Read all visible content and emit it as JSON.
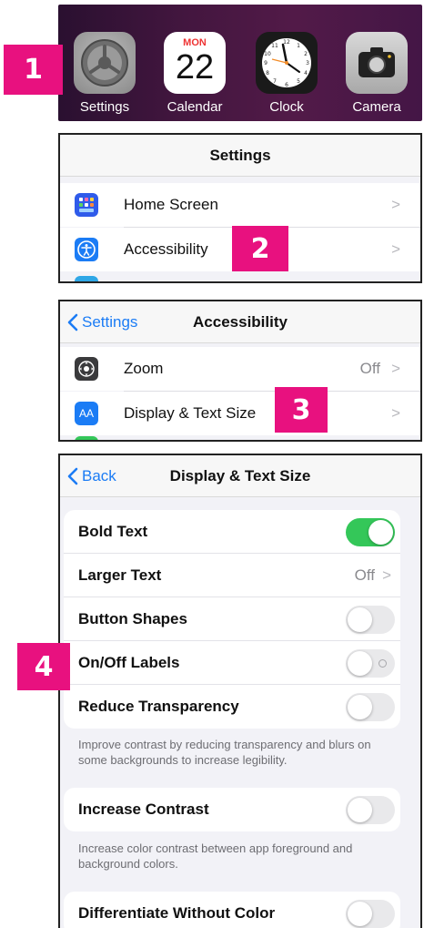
{
  "steps": [
    "1",
    "2",
    "3",
    "4"
  ],
  "home": {
    "apps": [
      {
        "label": "Settings",
        "icon": "settings-gear-icon"
      },
      {
        "label": "Calendar",
        "icon": "calendar-icon",
        "month": "MON",
        "day": "22"
      },
      {
        "label": "Clock",
        "icon": "clock-icon"
      },
      {
        "label": "Camera",
        "icon": "camera-icon"
      }
    ]
  },
  "settings": {
    "title": "Settings",
    "rows": [
      {
        "label": "Home Screen",
        "chevron": ">",
        "icon": "home-screen-icon"
      },
      {
        "label": "Accessibility",
        "chevron": ">",
        "icon": "accessibility-icon"
      }
    ]
  },
  "accessibility": {
    "back": "Settings",
    "title": "Accessibility",
    "rows": [
      {
        "label": "Zoom",
        "value": "Off",
        "chevron": ">",
        "icon": "zoom-icon"
      },
      {
        "label": "Display & Text Size",
        "chevron": ">",
        "icon": "display-text-size-icon",
        "icon_text": "AA"
      }
    ]
  },
  "display": {
    "back": "Back",
    "title": "Display & Text Size",
    "group1": [
      {
        "label": "Bold Text",
        "toggle": true
      },
      {
        "label": "Larger Text",
        "value": "Off",
        "chevron": ">"
      },
      {
        "label": "Button Shapes",
        "toggle": false
      },
      {
        "label": "On/Off Labels",
        "toggle": false
      },
      {
        "label": "Reduce Transparency",
        "toggle": false
      }
    ],
    "note1": "Improve contrast by reducing transparency and blurs on some backgrounds to increase legibility.",
    "group2": [
      {
        "label": "Increase Contrast",
        "toggle": false
      }
    ],
    "note2": "Increase color contrast between app foreground and background colors.",
    "group3": [
      {
        "label": "Differentiate Without Color",
        "toggle": false
      }
    ]
  },
  "colors": {
    "accent": "#e8117f",
    "ios_blue": "#1b7cf5",
    "toggle_on": "#34c759"
  }
}
